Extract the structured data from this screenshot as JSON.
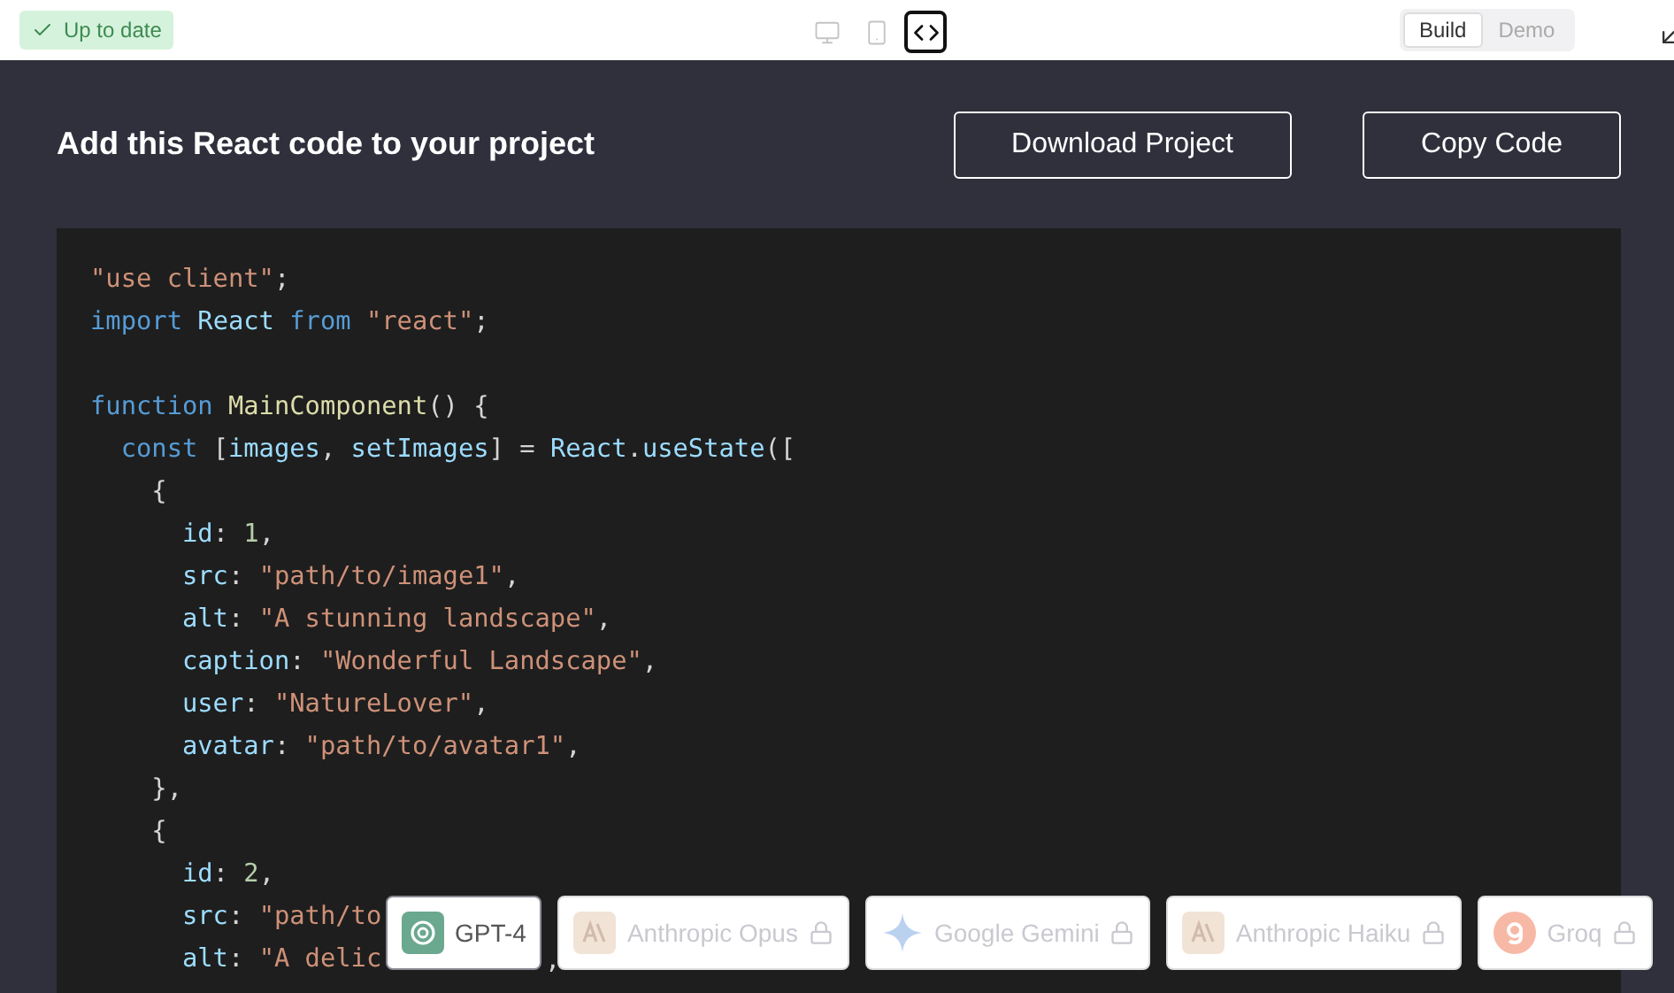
{
  "status_badge": {
    "label": "Up to date"
  },
  "view_modes": [
    {
      "kind": "desktop",
      "selected": false
    },
    {
      "kind": "mobile",
      "selected": false
    },
    {
      "kind": "code",
      "selected": true
    }
  ],
  "segmented": [
    {
      "label": "Build",
      "selected": true
    },
    {
      "label": "Demo",
      "selected": false
    }
  ],
  "heading": "Add this React code to your project",
  "actions": [
    "Download Project",
    "Copy Code"
  ],
  "code_lines": [
    {
      "kind": "code",
      "tokens": [
        {
          "string": "\"use client\""
        },
        {
          "plain": ";"
        }
      ]
    },
    {
      "kind": "code",
      "tokens": [
        {
          "keyword": "import "
        },
        {
          "variable": "React "
        },
        {
          "keyword": "from "
        },
        {
          "string": "\"react\""
        },
        {
          "plain": ";"
        }
      ]
    },
    {
      "kind": "blank"
    },
    {
      "kind": "code",
      "tokens": [
        {
          "keyword": "function "
        },
        {
          "function": "MainComponent"
        },
        {
          "plain": "() {"
        }
      ]
    },
    {
      "kind": "code",
      "tokens": [
        {
          "keyword": "  const"
        },
        {
          "plain": " ["
        },
        {
          "variable": "images"
        },
        {
          "plain": ", "
        },
        {
          "variable": "setImages"
        },
        {
          "plain": "] = "
        },
        {
          "variable": "React"
        },
        {
          "plain": "."
        },
        {
          "variable": "useState"
        },
        {
          "plain": "(["
        }
      ]
    },
    {
      "kind": "code",
      "tokens": [
        {
          "plain": "    {"
        }
      ]
    },
    {
      "kind": "code",
      "tokens": [
        {
          "variable": "      id"
        },
        {
          "plain": ": "
        },
        {
          "number": "1"
        },
        {
          "plain": ","
        }
      ]
    },
    {
      "kind": "code",
      "tokens": [
        {
          "variable": "      src"
        },
        {
          "plain": ": "
        },
        {
          "string": "\"path/to/image1\""
        },
        {
          "plain": ","
        }
      ]
    },
    {
      "kind": "code",
      "tokens": [
        {
          "variable": "      alt"
        },
        {
          "plain": ": "
        },
        {
          "string": "\"A stunning landscape\""
        },
        {
          "plain": ","
        }
      ]
    },
    {
      "kind": "code",
      "tokens": [
        {
          "variable": "      caption"
        },
        {
          "plain": ": "
        },
        {
          "string": "\"Wonderful Landscape\""
        },
        {
          "plain": ","
        }
      ]
    },
    {
      "kind": "code",
      "tokens": [
        {
          "variable": "      user"
        },
        {
          "plain": ": "
        },
        {
          "string": "\"NatureLover\""
        },
        {
          "plain": ","
        }
      ]
    },
    {
      "kind": "code",
      "tokens": [
        {
          "variable": "      avatar"
        },
        {
          "plain": ": "
        },
        {
          "string": "\"path/to/avatar1\""
        },
        {
          "plain": ","
        }
      ]
    },
    {
      "kind": "code",
      "tokens": [
        {
          "plain": "    },"
        }
      ]
    },
    {
      "kind": "code",
      "tokens": [
        {
          "plain": "    {"
        }
      ]
    },
    {
      "kind": "code",
      "tokens": [
        {
          "variable": "      id"
        },
        {
          "plain": ": "
        },
        {
          "number": "2"
        },
        {
          "plain": ","
        }
      ]
    },
    {
      "kind": "code",
      "tokens": [
        {
          "variable": "      src"
        },
        {
          "plain": ": "
        },
        {
          "string": "\"path/to"
        }
      ]
    },
    {
      "kind": "code",
      "tokens": [
        {
          "variable": "      alt"
        },
        {
          "plain": ": "
        },
        {
          "string": "\"A delic"
        }
      ]
    }
  ],
  "stray_comma": ",",
  "models": [
    {
      "name": "GPT-4",
      "kind": "openai",
      "selected": true,
      "locked": false
    },
    {
      "name": "Anthropic Opus",
      "kind": "anthropic",
      "selected": false,
      "locked": true
    },
    {
      "name": "Google Gemini",
      "kind": "gemini",
      "selected": false,
      "locked": true
    },
    {
      "name": "Anthropic Haiku",
      "kind": "anthropic",
      "selected": false,
      "locked": true
    },
    {
      "name": "Groq",
      "kind": "groq",
      "selected": false,
      "locked": true
    }
  ]
}
